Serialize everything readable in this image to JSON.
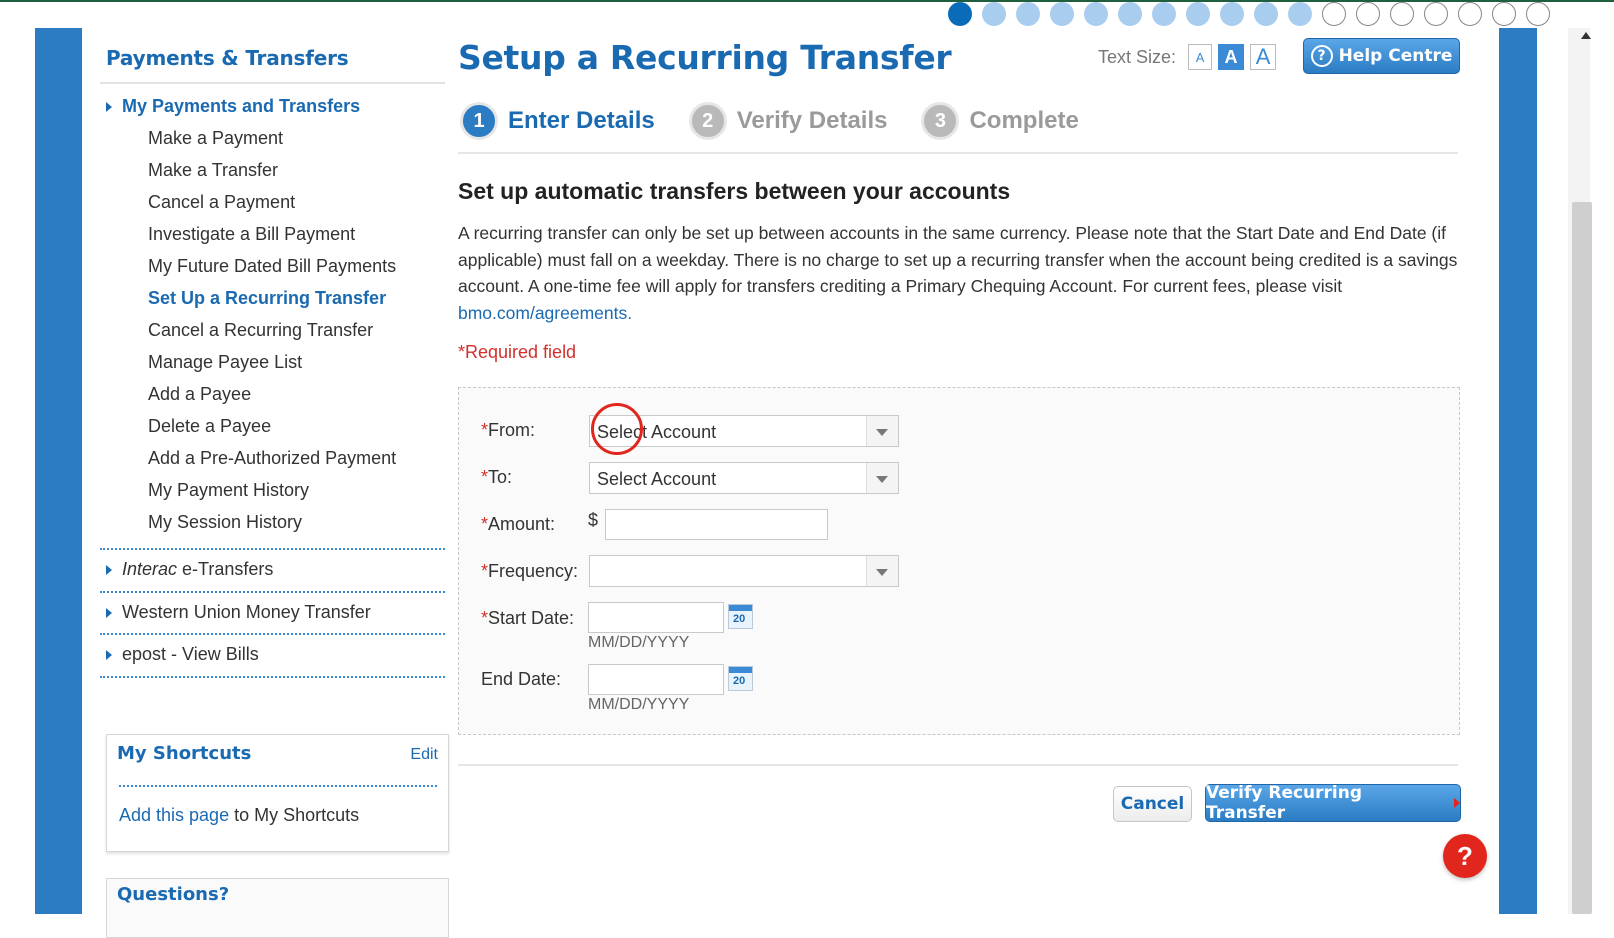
{
  "progress": {
    "total": 18,
    "current_index": 0,
    "completed": 11
  },
  "sidebar": {
    "title": "Payments & Transfers",
    "open_section": "My Payments and Transfers",
    "items": [
      {
        "label": "Make a Payment"
      },
      {
        "label": "Make a Transfer"
      },
      {
        "label": "Cancel a Payment"
      },
      {
        "label": "Investigate a Bill Payment"
      },
      {
        "label": "My Future Dated Bill Payments"
      },
      {
        "label": "Set Up a Recurring Transfer"
      },
      {
        "label": "Cancel a Recurring Transfer"
      },
      {
        "label": "Manage Payee List"
      },
      {
        "label": "Add a Payee"
      },
      {
        "label": "Delete a Payee"
      },
      {
        "label": "Add a Pre-Authorized Payment"
      },
      {
        "label": "My Payment History"
      },
      {
        "label": "My Session History"
      }
    ],
    "active_item": "Set Up a Recurring Transfer",
    "sections": [
      {
        "label_italic": "Interac",
        "label_rest": " e-Transfers"
      },
      {
        "label_italic": "",
        "label_rest": "Western Union Money Transfer"
      },
      {
        "label_italic": "",
        "label_rest": "epost - View Bills"
      }
    ],
    "shortcuts": {
      "title": "My Shortcuts",
      "edit": "Edit",
      "link_text": "Add this page",
      "link_suffix": " to My Shortcuts"
    },
    "questions": {
      "title": "Questions?"
    }
  },
  "main": {
    "title": "Setup a Recurring Transfer",
    "text_size": {
      "label": "Text Size:",
      "small": "A",
      "medium": "A",
      "large": "A"
    },
    "help": {
      "label": "Help Centre",
      "icon": "?"
    },
    "steps": [
      {
        "num": "1",
        "label": "Enter Details",
        "state": "active"
      },
      {
        "num": "2",
        "label": "Verify Details",
        "state": "inactive"
      },
      {
        "num": "3",
        "label": "Complete",
        "state": "inactive"
      }
    ],
    "subhead": "Set up automatic transfers between your accounts",
    "description": "A recurring transfer can only be set up between accounts in the same currency. Please note that the Start Date and End Date (if applicable) must fall on a weekday. There is no charge to set up a recurring transfer when the account being credited is a savings account. A one-time fee will apply for transfers crediting a Primary Chequing Account. For current fees, please visit ",
    "description_link": "bmo.com/agreements.",
    "required_note": "*Required field",
    "form": {
      "from": {
        "label": "From:",
        "value": "Select Account"
      },
      "to": {
        "label": "To:",
        "value": "Select Account"
      },
      "amount": {
        "label": "Amount:",
        "currency": "$",
        "value": ""
      },
      "frequency": {
        "label": "Frequency:",
        "value": ""
      },
      "start_date": {
        "label": "Start Date:",
        "value": "",
        "hint": "MM/DD/YYYY",
        "cal": "20"
      },
      "end_date": {
        "label": "End Date:",
        "value": "",
        "hint": "MM/DD/YYYY",
        "cal": "20"
      }
    },
    "buttons": {
      "cancel": "Cancel",
      "verify": "Verify Recurring Transfer"
    }
  },
  "help_fab": "?",
  "colors": {
    "brand_blue": "#2b7cc3",
    "link_blue": "#1a6ab2",
    "required_red": "#d0312d"
  }
}
